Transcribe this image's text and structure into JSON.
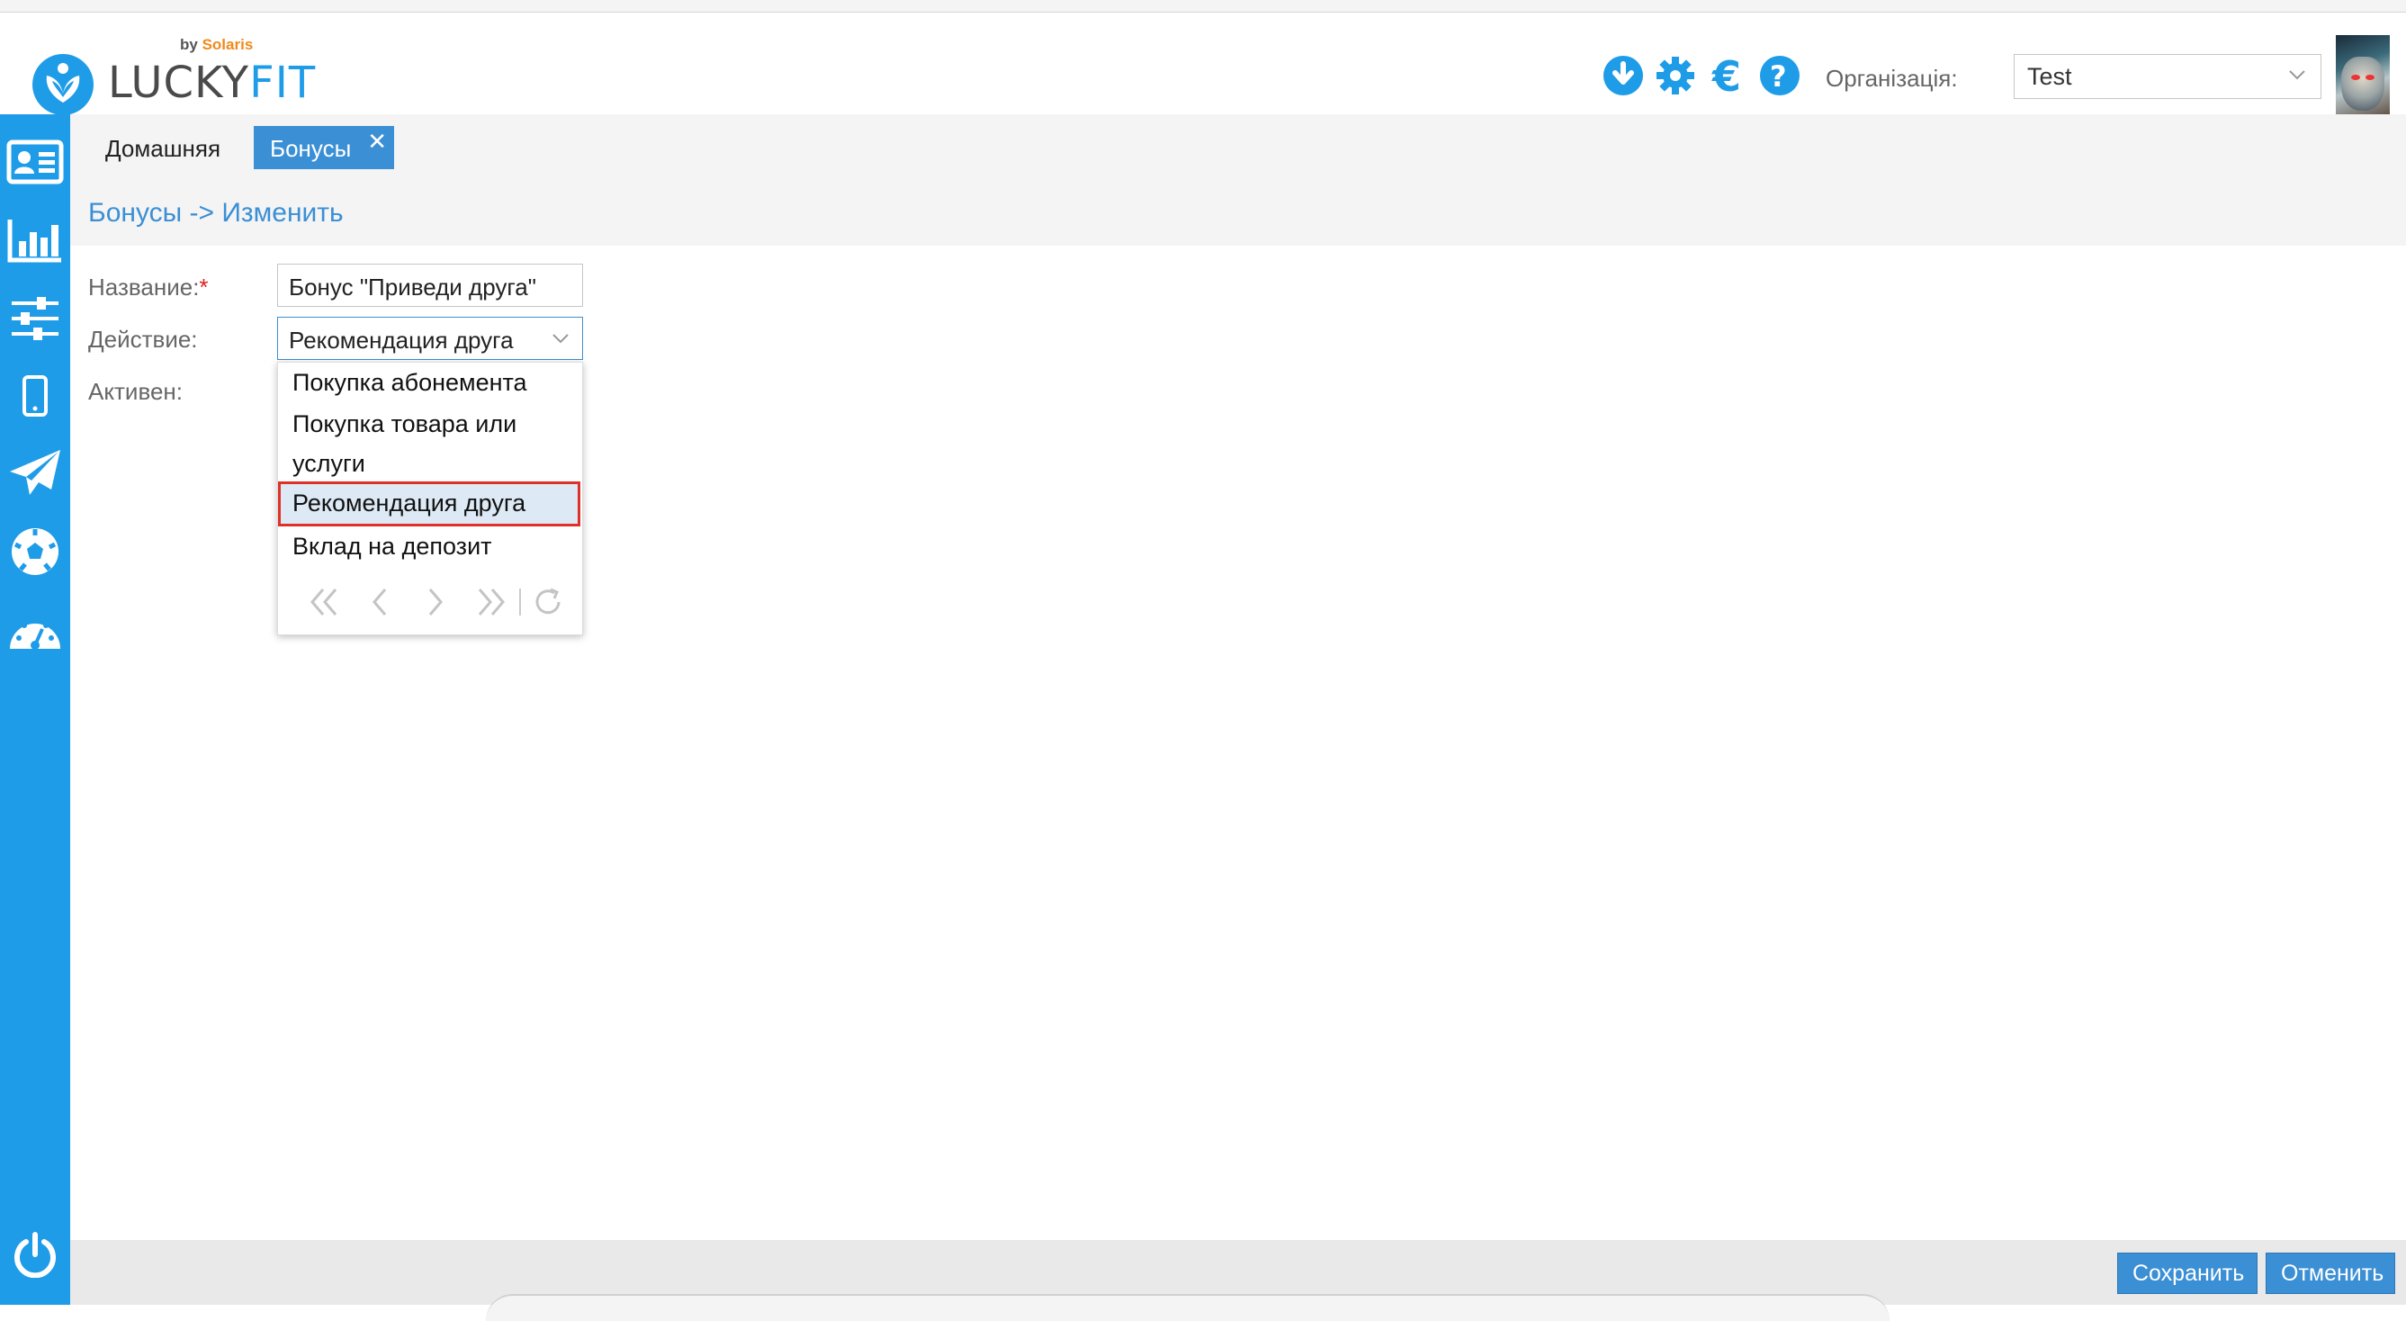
{
  "header": {
    "logo": {
      "brand_part1": "LUCKY",
      "brand_part2": "FIT",
      "by": "by",
      "by_brand": "Solaris"
    },
    "icons": [
      "download-icon",
      "gear-icon",
      "euro-icon",
      "help-icon"
    ],
    "org_label": "Організація:",
    "org_value": "Test"
  },
  "sidebar": {
    "items": [
      "contact-card-icon",
      "bar-chart-icon",
      "sliders-icon",
      "mobile-icon",
      "paper-plane-icon",
      "soccer-ball-icon",
      "dashboard-gauge-icon"
    ],
    "bottom": "power-icon"
  },
  "tabs": [
    {
      "label": "Домашняя",
      "active": false
    },
    {
      "label": "Бонусы",
      "active": true,
      "close": "✕"
    }
  ],
  "breadcrumb": "Бонусы -> Изменить",
  "form": {
    "name_label": "Название:",
    "required_mark": "*",
    "name_value": "Бонус \"Приведи друга\"",
    "action_label": "Действие:",
    "action_value": "Рекомендация друга",
    "active_label": "Активен:"
  },
  "dropdown": {
    "options": [
      "Покупка абонемента",
      "Покупка товара или",
      "услуги",
      "Рекомендация друга",
      "Вклад на депозит"
    ],
    "selected": "Рекомендация друга"
  },
  "footer": {
    "save_label": "Сохранить",
    "cancel_label": "Отменить"
  },
  "colors": {
    "accent": "#1e9ce8",
    "button": "#3b8fd4",
    "highlight": "#e0302a"
  }
}
